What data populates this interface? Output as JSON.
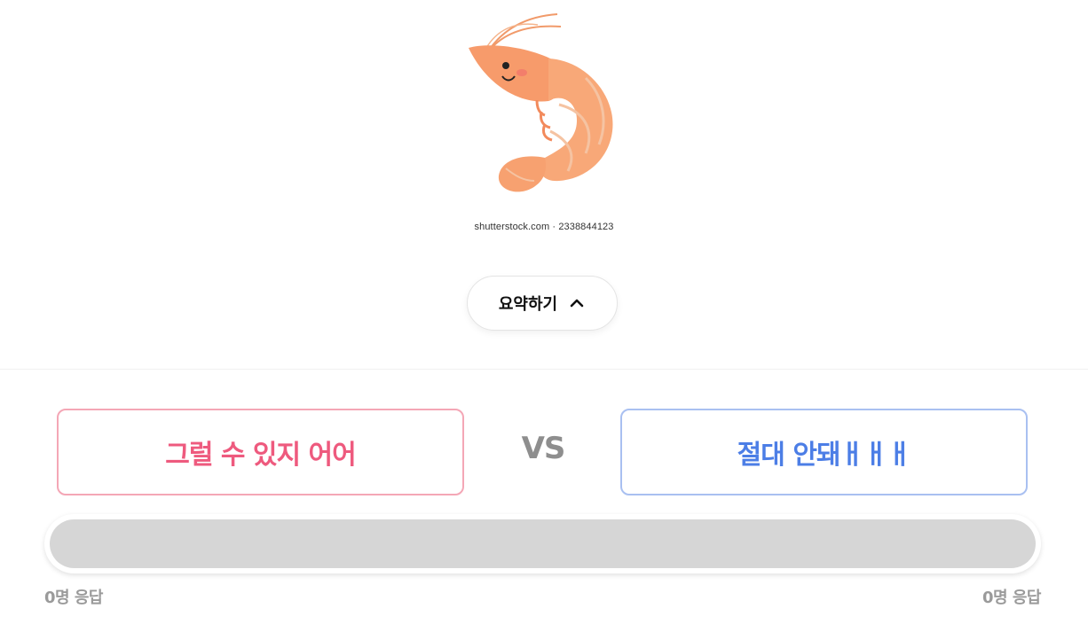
{
  "image": {
    "watermark": "shutterstock.com · 2338844123"
  },
  "summary_button": {
    "label": "요약하기",
    "icon": "chevron-up-icon"
  },
  "poll": {
    "option_a": {
      "label": "그럴 수 있지 어어",
      "color": "#ee5a7e",
      "border_color": "#f4a7b6",
      "responses": "0명 응답",
      "share": 0
    },
    "vs_label": "VS",
    "option_b": {
      "label": "절대 안돼ㅐㅐㅐ",
      "color": "#4c7ee6",
      "border_color": "#a9c0f1",
      "responses": "0명 응답",
      "share": 0
    },
    "bar_empty_color": "#d6d6d6"
  }
}
